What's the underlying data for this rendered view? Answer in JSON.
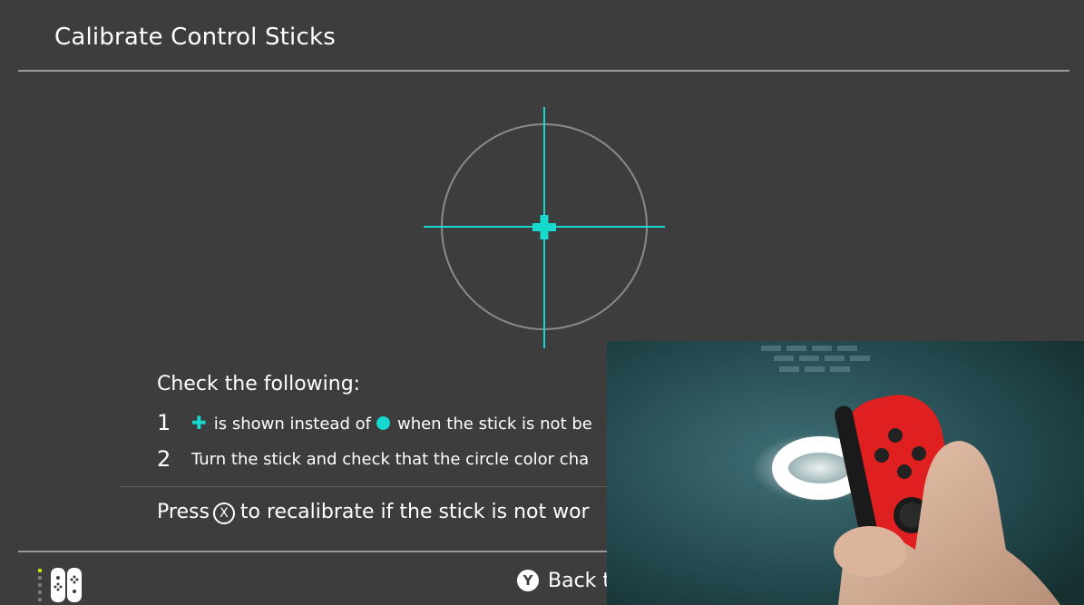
{
  "header": {
    "title": "Calibrate Control Sticks"
  },
  "instructions": {
    "heading": "Check the following:",
    "steps": [
      {
        "number": "1",
        "text_a": "is shown instead of",
        "text_b": "when the stick is not be"
      },
      {
        "number": "2",
        "text": "Turn the stick and check that the circle color cha"
      }
    ],
    "press_prefix": "Press",
    "x_button": "X",
    "press_suffix": "to recalibrate if the stick is not wor"
  },
  "footer": {
    "y_button": "Y",
    "back_label": "Back t"
  },
  "colors": {
    "background": "#3d3d3d",
    "accent": "#17d8cf",
    "divider": "#9a9a9a",
    "text": "#ffffff"
  },
  "icons": {
    "crosshair": "crosshair-icon",
    "plus": "plus-icon",
    "dot": "dot-icon",
    "x_button": "x-button-icon",
    "y_button": "y-button-icon",
    "joycon_status": "joycon-pair-icon"
  }
}
